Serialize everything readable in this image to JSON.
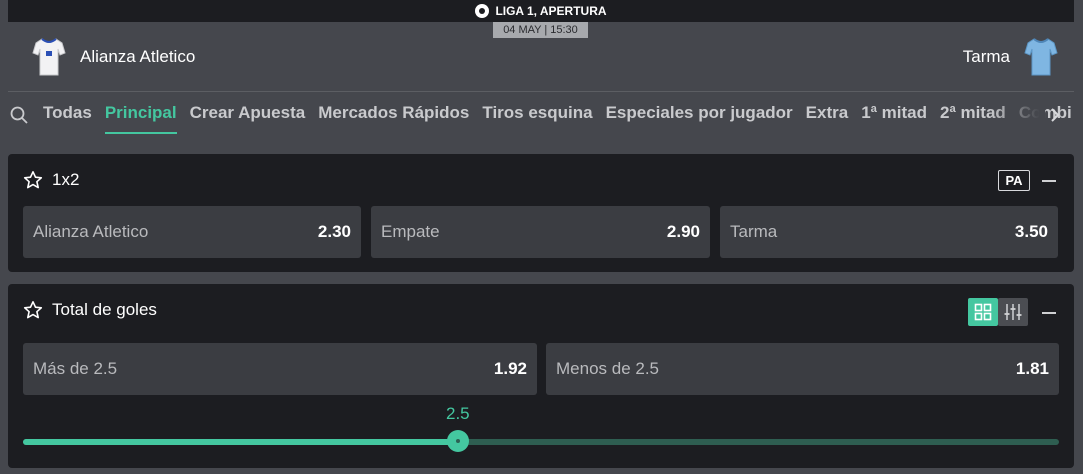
{
  "header": {
    "league": "LIGA 1, APERTURA",
    "datetime": "04 MAY | 15:30",
    "home_team": "Alianza Atletico",
    "away_team": "Tarma"
  },
  "tabs": [
    {
      "label": "Todas",
      "active": false
    },
    {
      "label": "Principal",
      "active": true
    },
    {
      "label": "Crear Apuesta",
      "active": false
    },
    {
      "label": "Mercados Rápidos",
      "active": false
    },
    {
      "label": "Tiros esquina",
      "active": false
    },
    {
      "label": "Especiales por jugador",
      "active": false
    },
    {
      "label": "Extra",
      "active": false
    },
    {
      "label": "1ª mitad",
      "active": false
    },
    {
      "label": "2ª mitad",
      "active": false
    },
    {
      "label": "Combi",
      "active": false
    }
  ],
  "markets": {
    "m1x2": {
      "title": "1x2",
      "badge": "PA",
      "outcomes": [
        {
          "label": "Alianza Atletico",
          "odds": "2.30"
        },
        {
          "label": "Empate",
          "odds": "2.90"
        },
        {
          "label": "Tarma",
          "odds": "3.50"
        }
      ]
    },
    "goals": {
      "title": "Total de goles",
      "outcomes": [
        {
          "label": "Más de 2.5",
          "odds": "1.92"
        },
        {
          "label": "Menos de 2.5",
          "odds": "1.81"
        }
      ],
      "line_value": "2.5",
      "slider_fraction": 0.42
    }
  },
  "colors": {
    "accent": "#44c7a0",
    "card_bg": "#1c1d21",
    "page_bg": "#45474d",
    "button_bg": "#3b3d42"
  },
  "icons": {
    "league": "soccer-ball-icon",
    "search": "search-icon",
    "next": "chevron-right-icon",
    "favorite": "star-icon",
    "collapse": "minus-icon",
    "grid_view": "grid-icon",
    "slider_view": "sliders-icon"
  }
}
